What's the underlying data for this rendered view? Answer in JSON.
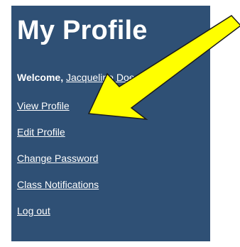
{
  "profile": {
    "title": "My Profile",
    "welcome_label": "Welcome,",
    "user_name": "Jacqueline Doe",
    "menu": [
      {
        "label": "View Profile"
      },
      {
        "label": "Edit Profile"
      },
      {
        "label": "Change Password"
      },
      {
        "label": "Class Notifications"
      },
      {
        "label": "Log out"
      }
    ]
  },
  "colors": {
    "panel_bg": "#2f5075",
    "arrow_fill": "#ffff00",
    "arrow_stroke": "#1a1a1a"
  },
  "annotation": {
    "icon": "yellow-arrow-icon"
  }
}
